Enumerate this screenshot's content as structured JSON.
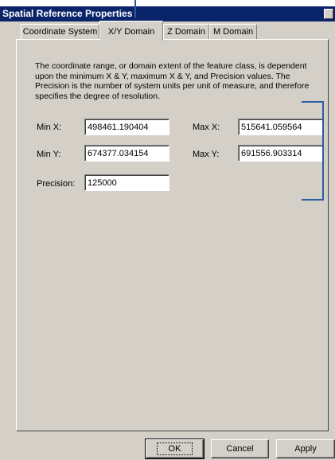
{
  "window": {
    "title": "Spatial Reference Properties"
  },
  "tabs": [
    {
      "label": "Coordinate System",
      "active": false
    },
    {
      "label": "X/Y Domain",
      "active": true
    },
    {
      "label": "Z Domain",
      "active": false
    },
    {
      "label": "M Domain",
      "active": false
    }
  ],
  "description": "The coordinate range, or domain extent of the feature class, is dependent upon the minimum X & Y, maximum X & Y, and Precision values. The Precision is the number of system units per unit of measure, and therefore specifies the degree of resolution.",
  "fields": {
    "min_x": {
      "label": "Min X:",
      "value": "498461.190404"
    },
    "max_x": {
      "label": "Max X:",
      "value": "515641.059564"
    },
    "min_y": {
      "label": "Min Y:",
      "value": "674377.034154"
    },
    "max_y": {
      "label": "Max Y:",
      "value": "691556.903314"
    },
    "precision": {
      "label": "Precision:",
      "value": "125000"
    }
  },
  "buttons": {
    "ok": "OK",
    "cancel": "Cancel",
    "apply": "Apply"
  },
  "colors": {
    "title_bar": "#0a246a",
    "dialog": "#d4d0c8",
    "callout": "#2a5d9f"
  }
}
